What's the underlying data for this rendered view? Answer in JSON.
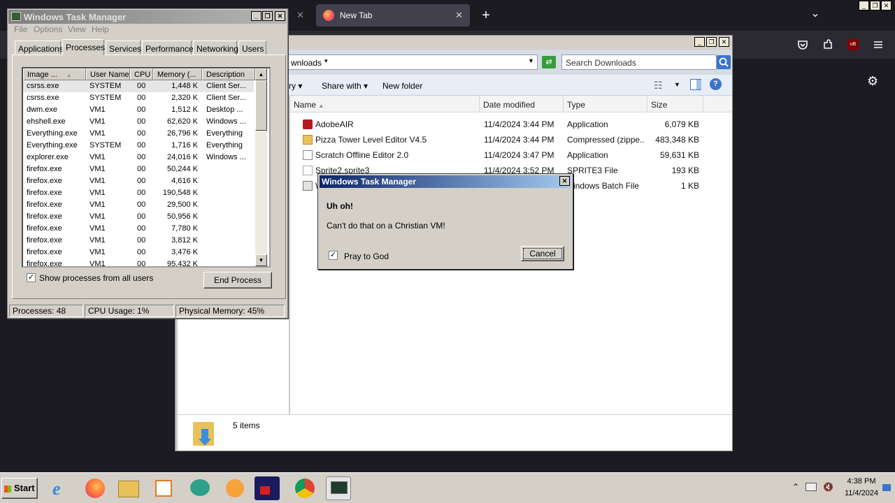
{
  "browser": {
    "tab_label": "New Tab",
    "tab_close": "✕",
    "prev_tab_close": "✕",
    "new_tab": "+",
    "list_all_tabs": "⌄",
    "toolbar_icons": [
      "pocket-icon",
      "extensions-icon",
      "ublock-icon",
      "menu-icon"
    ],
    "ublock_label": "uB",
    "settings_icon": "⚙"
  },
  "window_controls": {
    "minimize": "_",
    "maximize": "❐",
    "close": "✕"
  },
  "explorer": {
    "address_text": "wnloads",
    "search_placeholder": "Search Downloads",
    "toolbar": {
      "library_fragment": "ry",
      "share_with": "Share with",
      "new_folder": "New folder"
    },
    "columns": [
      "Name",
      "Date modified",
      "Type",
      "Size"
    ],
    "files": [
      {
        "name": "AdobeAIR",
        "date": "11/4/2024 3:44 PM",
        "type": "Application",
        "size": "6,079 KB",
        "icon": "adobe-air-icon"
      },
      {
        "name": "Pizza Tower Level Editor V4.5",
        "date": "11/4/2024 3:44 PM",
        "type": "Compressed (zippe...",
        "size": "483,348 KB",
        "icon": "zip-folder-icon"
      },
      {
        "name": "Scratch Offline Editor 2.0",
        "date": "11/4/2024 3:47 PM",
        "type": "Application",
        "size": "59,631 KB",
        "icon": "application-icon"
      },
      {
        "name": "Sprite2.sprite3",
        "date": "11/4/2024 3:52 PM",
        "type": "SPRITE3 File",
        "size": "193 KB",
        "icon": "file-icon"
      },
      {
        "name": "W",
        "date": "",
        "type": "indows Batch File",
        "size": "1 KB",
        "icon": "batch-file-icon"
      }
    ],
    "status": "5 items"
  },
  "taskmgr": {
    "title": "Windows Task Manager",
    "menu": [
      "File",
      "Options",
      "View",
      "Help"
    ],
    "tabs": [
      "Applications",
      "Processes",
      "Services",
      "Performance",
      "Networking",
      "Users"
    ],
    "columns": [
      "Image ...",
      "User Name",
      "CPU",
      "Memory (...",
      "Description"
    ],
    "processes": [
      {
        "image": "csrss.exe",
        "user": "SYSTEM",
        "cpu": "00",
        "mem": "1,448 K",
        "desc": "Client Ser..."
      },
      {
        "image": "csrss.exe",
        "user": "SYSTEM",
        "cpu": "00",
        "mem": "2,320 K",
        "desc": "Client Ser..."
      },
      {
        "image": "dwm.exe",
        "user": "VM1",
        "cpu": "00",
        "mem": "1,512 K",
        "desc": "Desktop ..."
      },
      {
        "image": "ehshell.exe",
        "user": "VM1",
        "cpu": "00",
        "mem": "62,620 K",
        "desc": "Windows ..."
      },
      {
        "image": "Everything.exe",
        "user": "VM1",
        "cpu": "00",
        "mem": "26,796 K",
        "desc": "Everything"
      },
      {
        "image": "Everything.exe",
        "user": "SYSTEM",
        "cpu": "00",
        "mem": "1,716 K",
        "desc": "Everything"
      },
      {
        "image": "explorer.exe",
        "user": "VM1",
        "cpu": "00",
        "mem": "24,016 K",
        "desc": "Windows ..."
      },
      {
        "image": "firefox.exe",
        "user": "VM1",
        "cpu": "00",
        "mem": "50,244 K",
        "desc": ""
      },
      {
        "image": "firefox.exe",
        "user": "VM1",
        "cpu": "00",
        "mem": "4,616 K",
        "desc": ""
      },
      {
        "image": "firefox.exe",
        "user": "VM1",
        "cpu": "00",
        "mem": "190,548 K",
        "desc": ""
      },
      {
        "image": "firefox.exe",
        "user": "VM1",
        "cpu": "00",
        "mem": "29,500 K",
        "desc": ""
      },
      {
        "image": "firefox.exe",
        "user": "VM1",
        "cpu": "00",
        "mem": "50,956 K",
        "desc": ""
      },
      {
        "image": "firefox.exe",
        "user": "VM1",
        "cpu": "00",
        "mem": "7,780 K",
        "desc": ""
      },
      {
        "image": "firefox.exe",
        "user": "VM1",
        "cpu": "00",
        "mem": "3,812 K",
        "desc": ""
      },
      {
        "image": "firefox.exe",
        "user": "VM1",
        "cpu": "00",
        "mem": "3,476 K",
        "desc": ""
      },
      {
        "image": "firefox.exe",
        "user": "VM1",
        "cpu": "00",
        "mem": "95,432 K",
        "desc": ""
      }
    ],
    "show_all_label": "Show processes from all users",
    "show_all_checked": "✓",
    "end_process": "End Process",
    "status": {
      "processes": "Processes: 48",
      "cpu": "CPU Usage: 1%",
      "memory": "Physical Memory: 45%"
    }
  },
  "dialog": {
    "title": "Windows Task Manager",
    "heading": "Uh oh!",
    "message": "Can't do that on a Christian VM!",
    "checkbox_label": "Pray to God",
    "checkbox_mark": "✓",
    "cancel": "Cancel",
    "close": "✕"
  },
  "taskbar": {
    "start": "Start",
    "apps": [
      "internet-explorer-icon",
      "firefox-icon",
      "file-explorer-icon",
      "media-icon",
      "chat-icon",
      "scratch-icon",
      "game-icon",
      "chrome-icon",
      "task-manager-icon"
    ],
    "clock_time": "4:38 PM",
    "clock_date": "11/4/2024",
    "tray_chevron": "⌃"
  }
}
